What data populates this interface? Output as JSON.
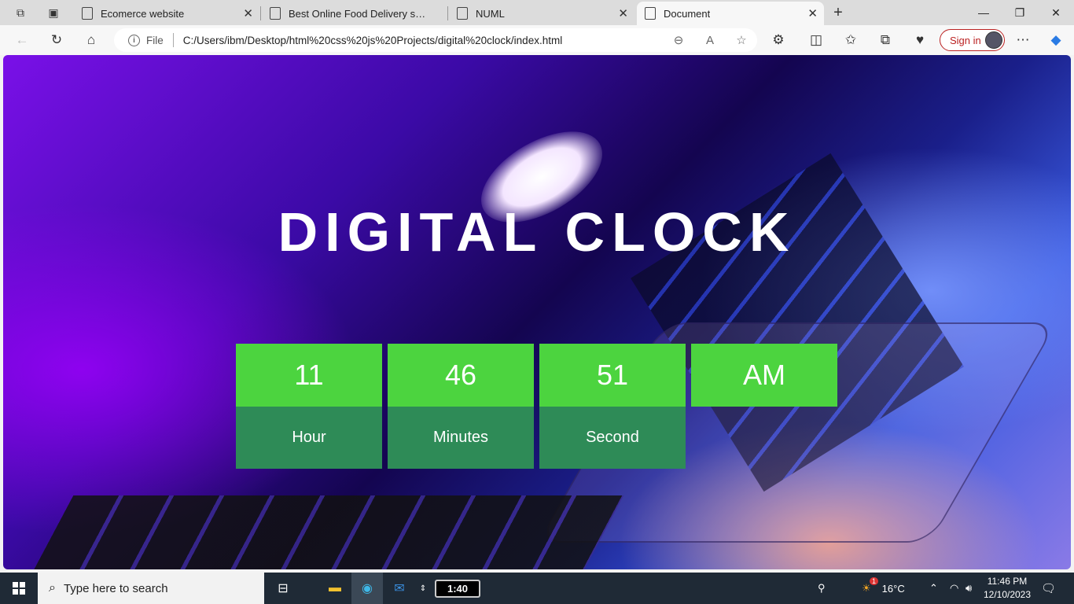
{
  "browser": {
    "tabs": [
      {
        "title": "Ecomerce website"
      },
      {
        "title": "Best Online Food Delivery service"
      },
      {
        "title": "NUML"
      },
      {
        "title": "Document"
      }
    ],
    "address": {
      "scheme": "File",
      "url": "C:/Users/ibm/Desktop/html%20css%20js%20Projects/digital%20clock/index.html"
    },
    "signin_label": "Sign in"
  },
  "page": {
    "title": "DIGITAL CLOCK",
    "units": [
      {
        "value": "11",
        "label": "Hour"
      },
      {
        "value": "46",
        "label": "Minutes"
      },
      {
        "value": "51",
        "label": "Second"
      },
      {
        "value": "AM",
        "label": ""
      }
    ]
  },
  "taskbar": {
    "search_placeholder": "Type here to search",
    "timer": "1:40",
    "weather": "16°C",
    "weather_badge": "1",
    "time": "11:46 PM",
    "date": "12/10/2023"
  },
  "colors": {
    "value_bg": "#4cd43f",
    "label_bg": "#2e8b57",
    "signin_accent": "#b22222"
  }
}
